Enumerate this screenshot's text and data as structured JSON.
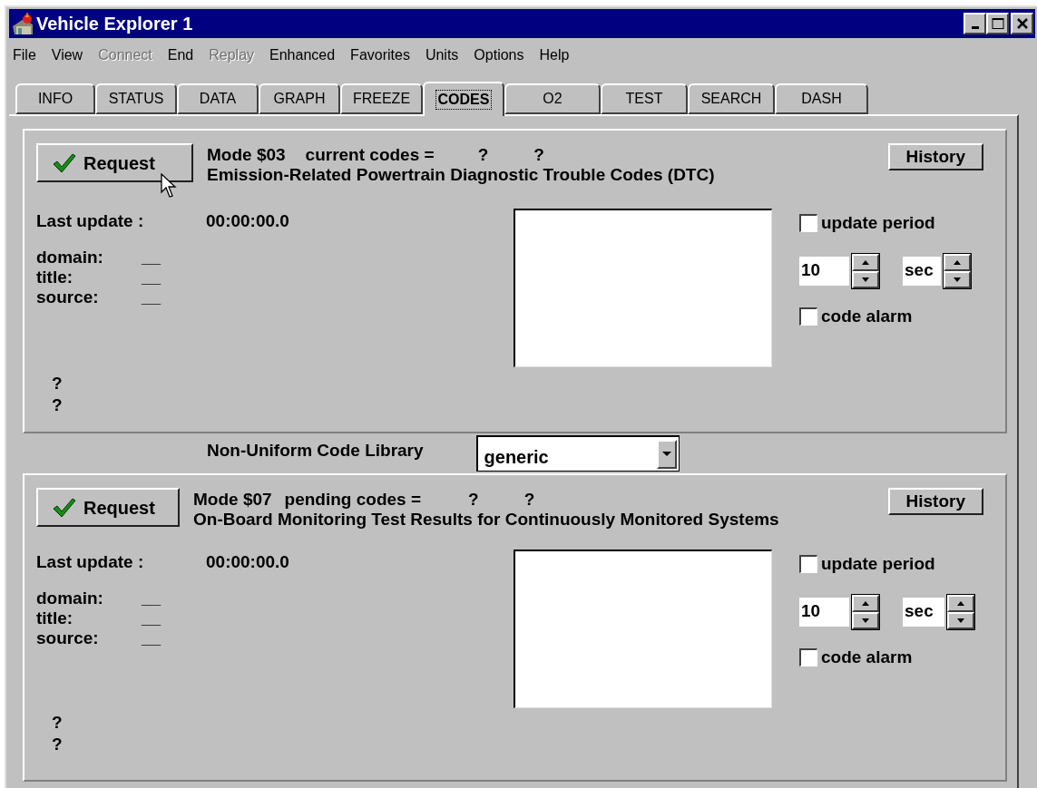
{
  "window": {
    "title": "Vehicle Explorer 1"
  },
  "menu": [
    {
      "label": "File",
      "disabled": false
    },
    {
      "label": "View",
      "disabled": false
    },
    {
      "label": "Connect",
      "disabled": true
    },
    {
      "label": "End",
      "disabled": false
    },
    {
      "label": "Replay",
      "disabled": true
    },
    {
      "label": "Enhanced",
      "disabled": false
    },
    {
      "label": "Favorites",
      "disabled": false
    },
    {
      "label": "Units",
      "disabled": false
    },
    {
      "label": "Options",
      "disabled": false
    },
    {
      "label": "Help",
      "disabled": false
    }
  ],
  "tabs": [
    {
      "label": "INFO",
      "selected": false
    },
    {
      "label": "STATUS",
      "selected": false
    },
    {
      "label": "DATA",
      "selected": false
    },
    {
      "label": "GRAPH",
      "selected": false
    },
    {
      "label": "FREEZE",
      "selected": false
    },
    {
      "label": "CODES",
      "selected": true
    },
    {
      "label": "O2",
      "selected": false
    },
    {
      "label": "TEST",
      "selected": false
    },
    {
      "label": "SEARCH",
      "selected": false
    },
    {
      "label": "DASH",
      "selected": false
    }
  ],
  "sections": [
    {
      "request": "Request",
      "mode": "Mode $03",
      "label": "current codes =",
      "codes": [
        "?",
        "?"
      ],
      "description": "Emission-Related Powertrain Diagnostic Trouble Codes (DTC)",
      "history": "History",
      "last_update_label": "Last update :",
      "last_update": "00:00:00.0",
      "fields": [
        {
          "label": "domain:",
          "value": "__"
        },
        {
          "label": "title:",
          "value": "__"
        },
        {
          "label": "source:",
          "value": "__"
        }
      ],
      "update_period": {
        "label": "update period",
        "checked": false
      },
      "period_value": "10",
      "period_unit": "sec",
      "code_alarm": {
        "label": "code alarm",
        "checked": false
      },
      "status": [
        "?",
        "?"
      ]
    },
    {
      "request": "Request",
      "mode": "Mode $07",
      "label": "pending codes =",
      "codes": [
        "?",
        "?"
      ],
      "description": "On-Board Monitoring Test Results for Continuously Monitored Systems",
      "history": "History",
      "last_update_label": "Last update :",
      "last_update": "00:00:00.0",
      "fields": [
        {
          "label": "domain:",
          "value": "__"
        },
        {
          "label": "title:",
          "value": "__"
        },
        {
          "label": "source:",
          "value": "__"
        }
      ],
      "update_period": {
        "label": "update period",
        "checked": false
      },
      "period_value": "10",
      "period_unit": "sec",
      "code_alarm": {
        "label": "code alarm",
        "checked": false
      },
      "status": [
        "?",
        "?"
      ]
    }
  ],
  "library": {
    "label": "Non-Uniform Code Library",
    "value": "generic"
  }
}
